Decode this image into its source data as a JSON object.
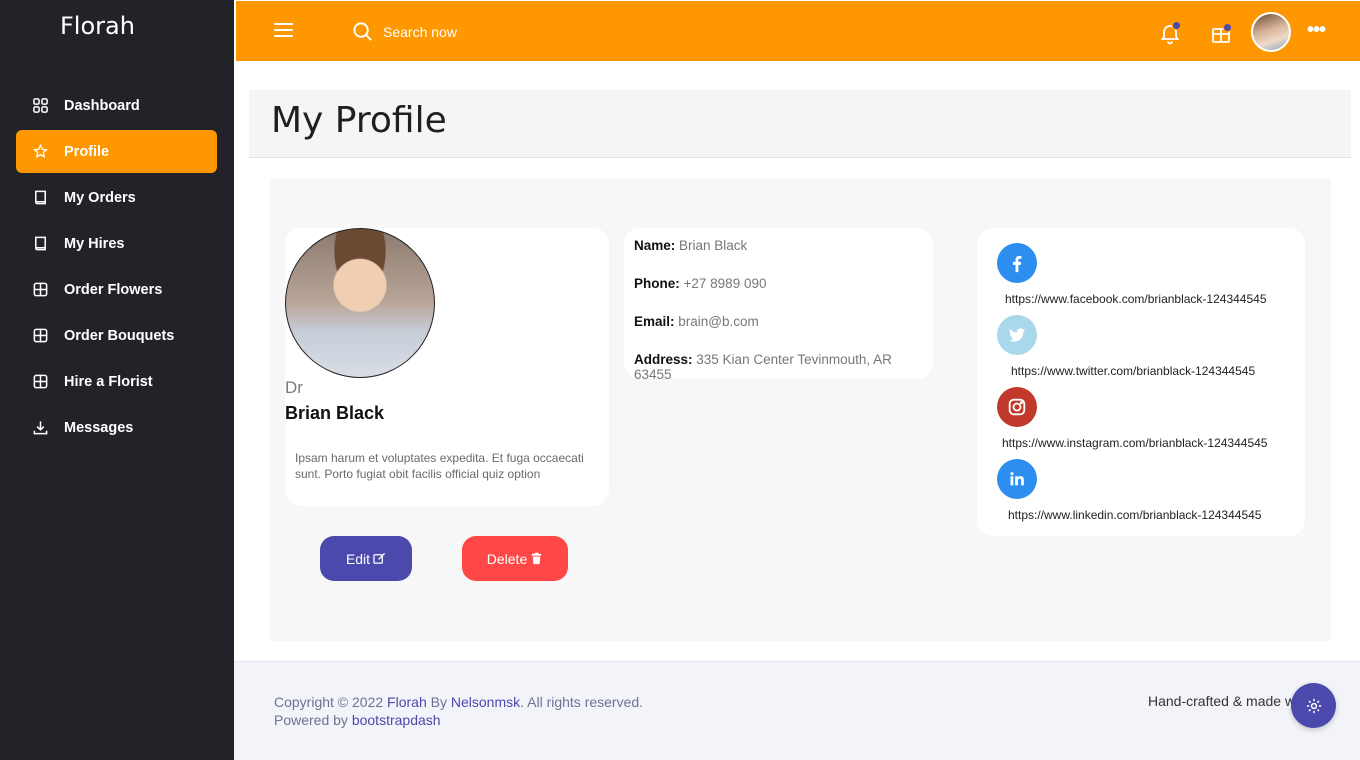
{
  "brand": "Florah",
  "sidebar": {
    "items": [
      {
        "label": "Dashboard",
        "icon": "grid-icon"
      },
      {
        "label": "Profile",
        "icon": "star-icon",
        "active": true
      },
      {
        "label": "My Orders",
        "icon": "book-icon"
      },
      {
        "label": "My Hires",
        "icon": "book-icon"
      },
      {
        "label": "Order Flowers",
        "icon": "grid-square-icon"
      },
      {
        "label": "Order Bouquets",
        "icon": "grid-square-icon"
      },
      {
        "label": "Hire a Florist",
        "icon": "grid-square-icon"
      },
      {
        "label": "Messages",
        "icon": "download-icon"
      }
    ]
  },
  "topbar": {
    "search_label": "Search now"
  },
  "page": {
    "title": "My Profile"
  },
  "profile": {
    "prefix": "Dr",
    "name": "Brian Black",
    "bio": "Ipsam harum et voluptates expedita. Et fuga occaecati sunt. Porto fugiat obit facilis official quiz option"
  },
  "actions": {
    "edit_label": "Edit",
    "delete_label": "Delete"
  },
  "info": {
    "name_label": "Name:",
    "name_value": "Brian Black",
    "phone_label": "Phone:",
    "phone_value": "+27 8989 090",
    "email_label": "Email:",
    "email_value": "brain@b.com",
    "address_label": "Address:",
    "address_value": "335 Kian Center Tevinmouth, AR 63455"
  },
  "social": {
    "facebook": "https://www.facebook.com/brianblack-124344545",
    "twitter": "https://www.twitter.com/brianblack-124344545",
    "instagram": "https://www.instagram.com/brianblack-124344545",
    "linkedin": "https://www.linkedin.com/brianblack-124344545"
  },
  "footer": {
    "copy_prefix": "Copyright © 2022 ",
    "copy_brand": "Florah",
    "copy_by": " By ",
    "copy_author": "Nelsonmsk",
    "copy_suffix": ". All rights reserved.",
    "powered_prefix": "Powered by ",
    "powered_link": "bootstrapdash",
    "handcrafted": "Hand-crafted & made wi"
  },
  "colors": {
    "accent": "#ff9800",
    "primary": "#4b49ac",
    "danger": "#ff4747",
    "sidebar": "#222329"
  }
}
